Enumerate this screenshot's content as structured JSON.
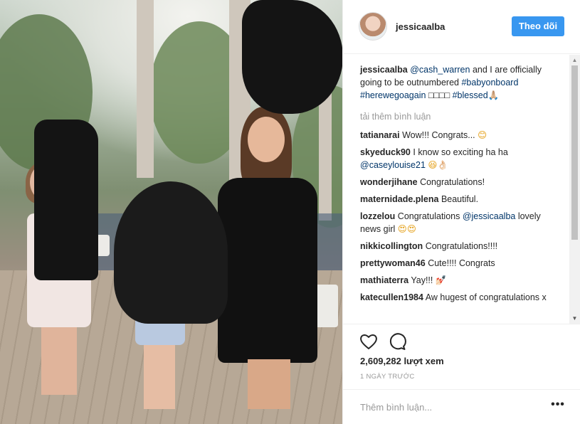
{
  "header": {
    "username": "jessicaalba",
    "follow_label": "Theo dõi"
  },
  "caption": {
    "username": "jessicaalba",
    "mention": "@cash_warren",
    "text_1": " and I are officially going to be outnumbered ",
    "hashtag_1": "#babyonboard",
    "hashtag_2": "#herewegoagain",
    "emojis": " □□□□ ",
    "hashtag_3": "#blessed",
    "emoji_end": "🙏🏼"
  },
  "load_more_label": "tải thêm bình luận",
  "comments": [
    {
      "user": "tatianarai",
      "text": "Wow!!! Congrats... ",
      "emoji": "😊"
    },
    {
      "user": "skyeduck90",
      "text": "I know so exciting ha ha ",
      "mention": "@caseylouise21",
      "emoji": " 😆👌🏻"
    },
    {
      "user": "wonderjihane",
      "text": "Congratulations!"
    },
    {
      "user": "maternidade.plena",
      "text": "Beautiful."
    },
    {
      "user": "lozzelou",
      "text": "Congratulations ",
      "mention": "@jessicaalba",
      "text2": " lovely news girl ",
      "emoji": "😍😍"
    },
    {
      "user": "nikkicollington",
      "text": "Congratulations!!!!"
    },
    {
      "user": "prettywoman46",
      "text": "Cute!!!! Congrats"
    },
    {
      "user": "mathiaterra",
      "text": "Yay!!! ",
      "emoji": "💅🏻"
    },
    {
      "user": "katecullen1984",
      "text": "Aw hugest of congratulations x"
    }
  ],
  "actions": {
    "views": "2,609,282 lượt xem",
    "date": "1 NGÀY TRƯỚC"
  },
  "add_comment": {
    "placeholder": "Thêm bình luận...",
    "more_label": "•••"
  },
  "colors": {
    "follow_button": "#3897f0",
    "link": "#003569",
    "muted": "#999999"
  },
  "icons": [
    "heart-icon",
    "comment-icon",
    "more-options-icon",
    "scroll-up-icon",
    "scroll-down-icon"
  ]
}
